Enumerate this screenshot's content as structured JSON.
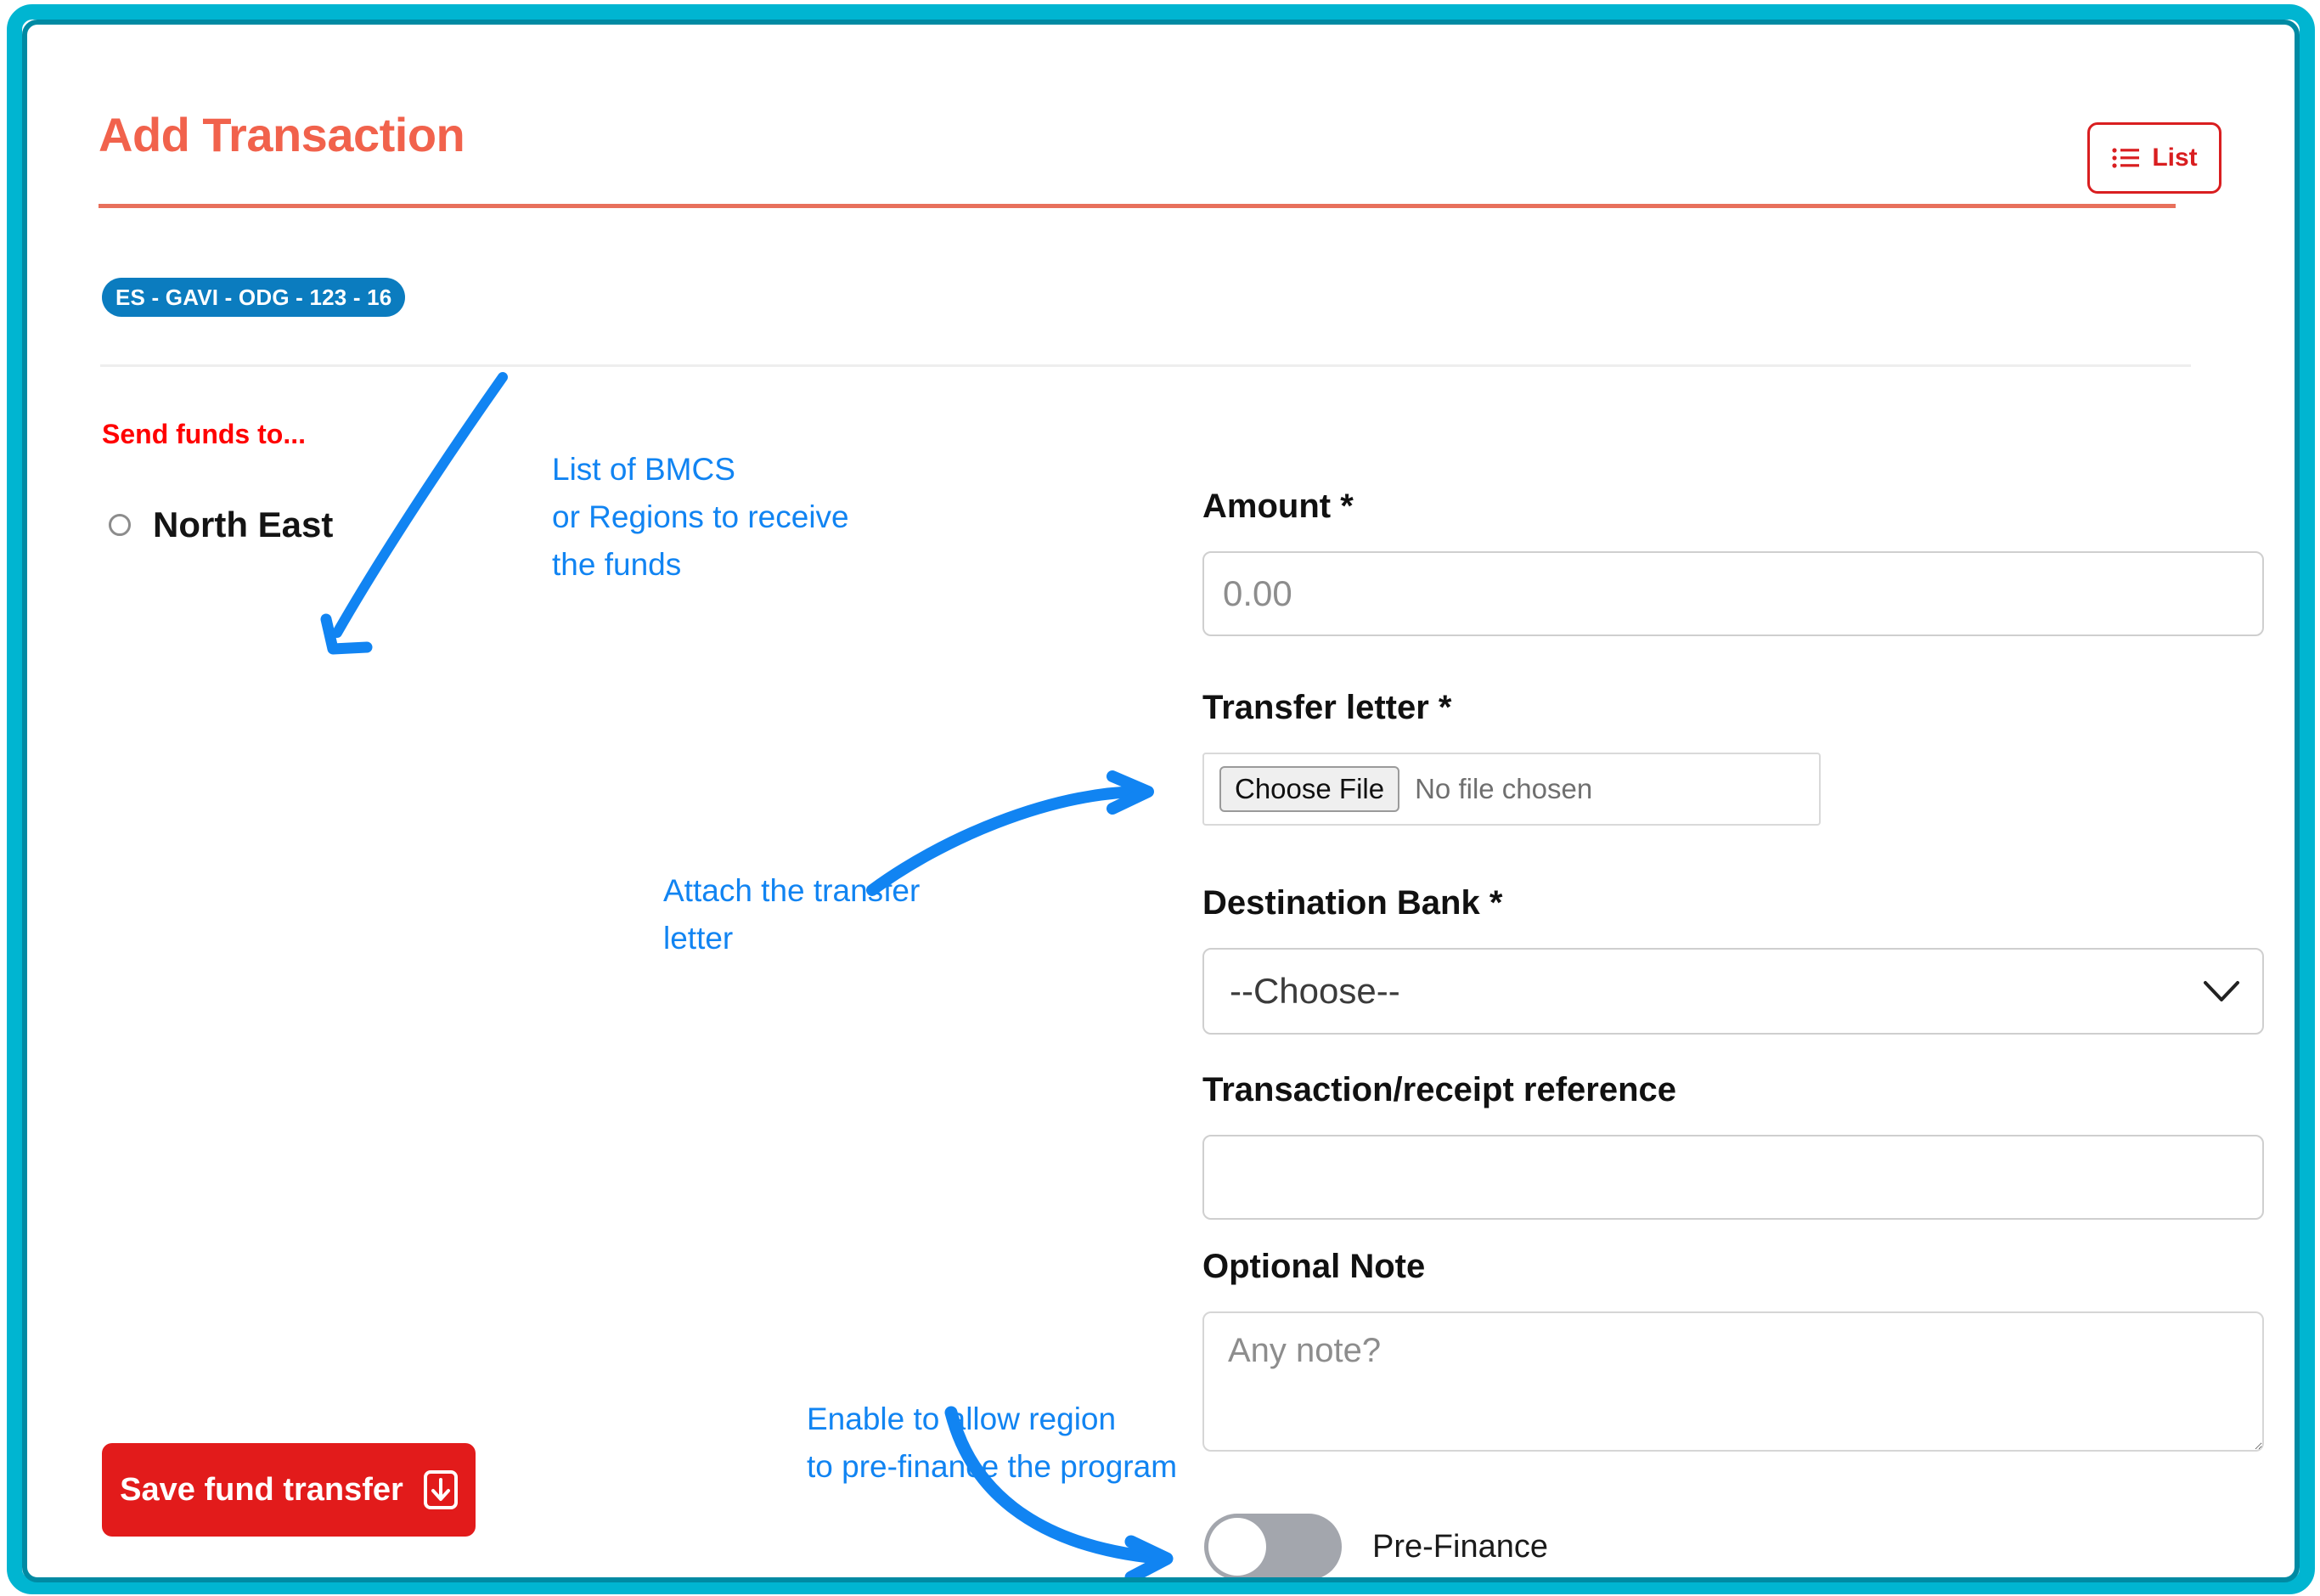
{
  "frame": {
    "outer_color": "#00b5d1",
    "inner_color": "#008aa3"
  },
  "header": {
    "title": "Add Transaction",
    "title_color": "#f1624c",
    "list_button": {
      "label": "List",
      "icon": "list-icon",
      "color": "#d91e20"
    }
  },
  "badge": {
    "text": "ES - GAVI - ODG - 123 - 16",
    "color": "#0b7cbf"
  },
  "left": {
    "send_funds_label": "Send funds to...",
    "send_funds_color": "#ff0000",
    "recipients": [
      {
        "label": "North East",
        "selected": false
      }
    ],
    "save_button": {
      "label": "Save fund transfer",
      "icon": "save-download-icon",
      "color": "#e21b1b"
    }
  },
  "form": {
    "amount": {
      "label": "Amount *",
      "value": "",
      "placeholder": "0.00"
    },
    "transfer_letter": {
      "label": "Transfer letter *",
      "choose_file_label": "Choose File",
      "file_status": "No file chosen"
    },
    "destination_bank": {
      "label": "Destination Bank *",
      "selected": "--Choose--",
      "options": [
        "--Choose--"
      ]
    },
    "reference": {
      "label": "Transaction/receipt reference",
      "value": "",
      "placeholder": ""
    },
    "note": {
      "label": "Optional Note",
      "value": "",
      "placeholder": "Any note?"
    },
    "pre_finance": {
      "label": "Pre-Finance",
      "enabled": false
    }
  },
  "annotations": {
    "color": "#1184f2",
    "one": "List of BMCS\nor Regions to receive\nthe funds",
    "two": "Attach the transfer\nletter",
    "three": "Enable to allow region\nto pre-finance the program"
  }
}
